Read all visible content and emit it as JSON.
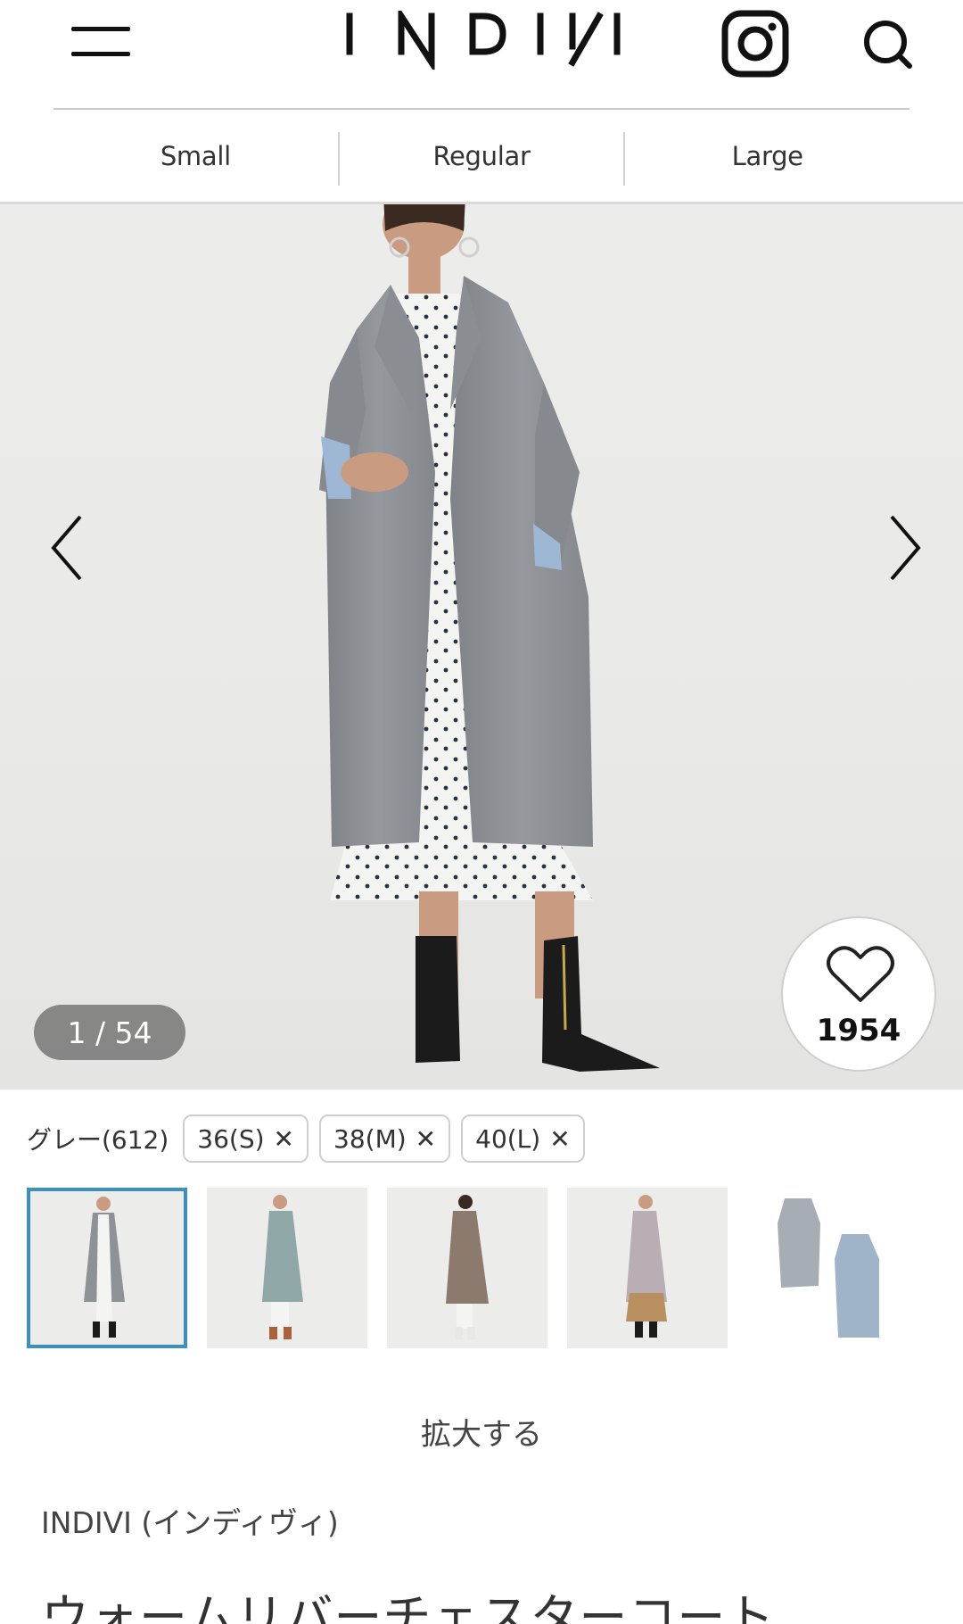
{
  "header": {
    "menu_icon": "hamburger-icon",
    "brand_logo": "INDIVI",
    "instagram_icon": "instagram-icon",
    "search_icon": "search-icon"
  },
  "size_tabs": [
    {
      "label": "Small"
    },
    {
      "label": "Regular"
    },
    {
      "label": "Large"
    }
  ],
  "gallery": {
    "counter": "1 / 54",
    "prev_icon": "chevron-left-icon",
    "next_icon": "chevron-right-icon",
    "favorite_icon": "heart-outline-icon",
    "favorite_count": "1954"
  },
  "variant": {
    "color_label": "グレー(612)",
    "sizes": [
      {
        "label": "36(S)",
        "icon": "close-icon"
      },
      {
        "label": "38(M)",
        "icon": "close-icon"
      },
      {
        "label": "40(L)",
        "icon": "close-icon"
      }
    ]
  },
  "thumbnails": [
    {
      "name": "gray",
      "coat_color": "#8e9196",
      "active": true
    },
    {
      "name": "sage",
      "coat_color": "#8fa7a6",
      "active": false
    },
    {
      "name": "brown",
      "coat_color": "#8c7a6e",
      "active": false
    },
    {
      "name": "lilac",
      "coat_color": "#b8aeb4",
      "active": false
    },
    {
      "name": "flat-lay",
      "coat_color": "#9fb3c9",
      "active": false
    }
  ],
  "zoom_label": "拡大する",
  "product": {
    "brand": "INDIVI (インディヴィ)",
    "title": "ウォームリバーチェスターコート"
  },
  "colors": {
    "accent_selected": "#3d8fbd",
    "counter_bg": "#5a5a5a",
    "coat_gray": "#8e9196"
  }
}
